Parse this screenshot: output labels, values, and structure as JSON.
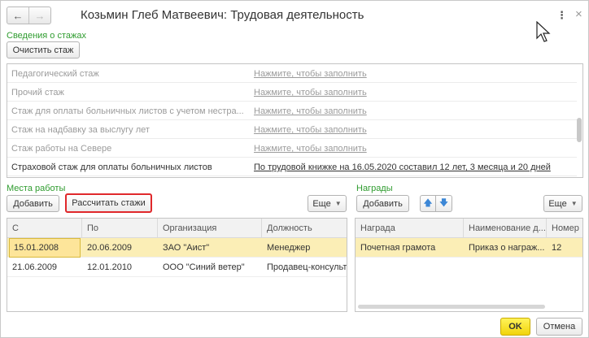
{
  "window": {
    "title": "Козьмин Глеб Матвеевич: Трудовая деятельность",
    "nav": {
      "back_icon": "←",
      "forward_icon": "→"
    },
    "menu_icon": "⋮",
    "close_icon": "×"
  },
  "stazh_section": {
    "label": "Сведения о стажах",
    "clear_button": "Очистить стаж",
    "rows": [
      {
        "label": "Педагогический стаж",
        "value": "Нажмите, чтобы заполнить"
      },
      {
        "label": "Прочий стаж",
        "value": "Нажмите, чтобы заполнить"
      },
      {
        "label": "Стаж для оплаты больничных листов с учетом нестра...",
        "value": "Нажмите, чтобы заполнить"
      },
      {
        "label": "Стаж на надбавку за выслугу лет",
        "value": "Нажмите, чтобы заполнить"
      },
      {
        "label": "Стаж работы на Севере",
        "value": "Нажмите, чтобы заполнить"
      },
      {
        "label": "Страховой стаж для оплаты больничных листов",
        "value": "По трудовой книжке на 16.05.2020 составил 12 лет, 3 месяца и 20 дней"
      }
    ]
  },
  "work_places": {
    "label": "Места работы",
    "add_button": "Добавить",
    "calc_button": "Рассчитать стажи",
    "more_button": "Еще",
    "columns": [
      "С",
      "По",
      "Организация",
      "Должность"
    ],
    "rows": [
      [
        "15.01.2008",
        "20.06.2009",
        "ЗАО \"Аист\"",
        "Менеджер"
      ],
      [
        "21.06.2009",
        "12.01.2010",
        "ООО \"Синий ветер\"",
        "Продавец-консультант"
      ]
    ]
  },
  "awards": {
    "label": "Награды",
    "add_button": "Добавить",
    "up_icon": "🡅",
    "down_icon": "🡇",
    "more_button": "Еще",
    "columns": [
      "Награда",
      "Наименование д...",
      "Номер"
    ],
    "rows": [
      [
        "Почетная грамота",
        "Приказ о награж...",
        "12"
      ]
    ]
  },
  "footer": {
    "ok_button": "OK",
    "cancel_button": "Отмена"
  },
  "colors": {
    "section_label": "#2f9c2f",
    "selected_row": "#fbeeb6",
    "ok_button": "#f5dc1b",
    "highlight_border": "#e0282b"
  }
}
